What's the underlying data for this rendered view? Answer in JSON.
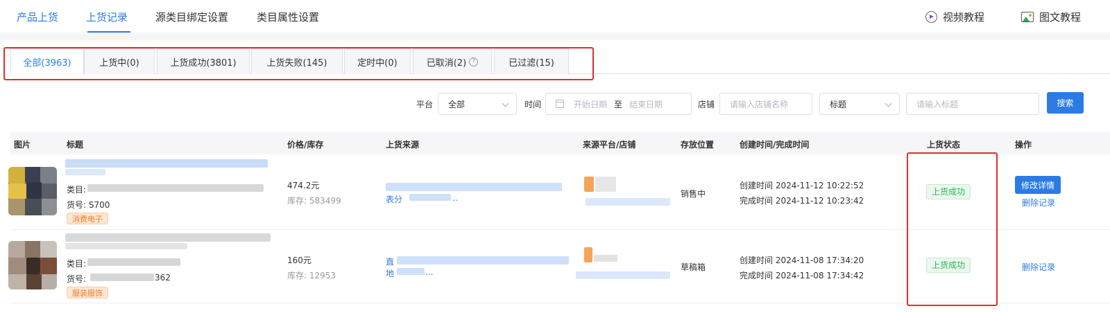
{
  "top_nav": {
    "items": [
      "产品上货",
      "上货记录",
      "源类目绑定设置",
      "类目属性设置"
    ],
    "video_tutorial": "视频教程",
    "image_tutorial": "图文教程"
  },
  "status_tabs": [
    "全部(3963)",
    "上货中(0)",
    "上货成功(3801)",
    "上货失败(145)",
    "定时中(0)",
    "已取消(2)",
    "已过滤(15)"
  ],
  "filters": {
    "platform_label": "平台",
    "platform_value": "全部",
    "time_label": "时间",
    "start_placeholder": "开始日期",
    "date_sep": "至",
    "end_placeholder": "结束日期",
    "shop_label": "店铺",
    "shop_placeholder": "请输入店铺名称",
    "field_select": "标题",
    "title_placeholder": "请输入标题",
    "search_label": "搜索"
  },
  "table": {
    "columns": [
      "图片",
      "标题",
      "价格/库存",
      "上货来源",
      "来源平台/店铺",
      "存放位置",
      "创建时间/完成时间",
      "上货状态",
      "操作"
    ],
    "rows": [
      {
        "category_label": "类目:",
        "sku_label": "货号: S700",
        "tag": "消费电子",
        "price": "474.2元",
        "stock": "库存: 583499",
        "source_text": "表分",
        "source_more": "..",
        "location": "销售中",
        "created": "创建时间 2024-11-12 10:22:52",
        "completed": "完成时间 2024-11-12 10:23:42",
        "status": "上货成功",
        "edit_label": "修改详情",
        "delete_label": "删除记录"
      },
      {
        "category_label": "类目:",
        "sku_label": "货号:",
        "sku_suffix": "362",
        "tag": "服装服饰",
        "price": "160元",
        "stock": "库存: 12953",
        "source_text": "直",
        "source_line2": "地",
        "source_more": "...",
        "location": "草稿箱",
        "created": "创建时间 2024-11-08 17:34:20",
        "completed": "完成时间 2024-11-08 17:34:42",
        "status": "上货成功",
        "delete_label": "删除记录"
      }
    ]
  },
  "colors": {
    "accent": "#2c7be5",
    "success": "#2fb157",
    "highlight_box": "#e02d2d",
    "tag_orange": "#f07c2d"
  }
}
